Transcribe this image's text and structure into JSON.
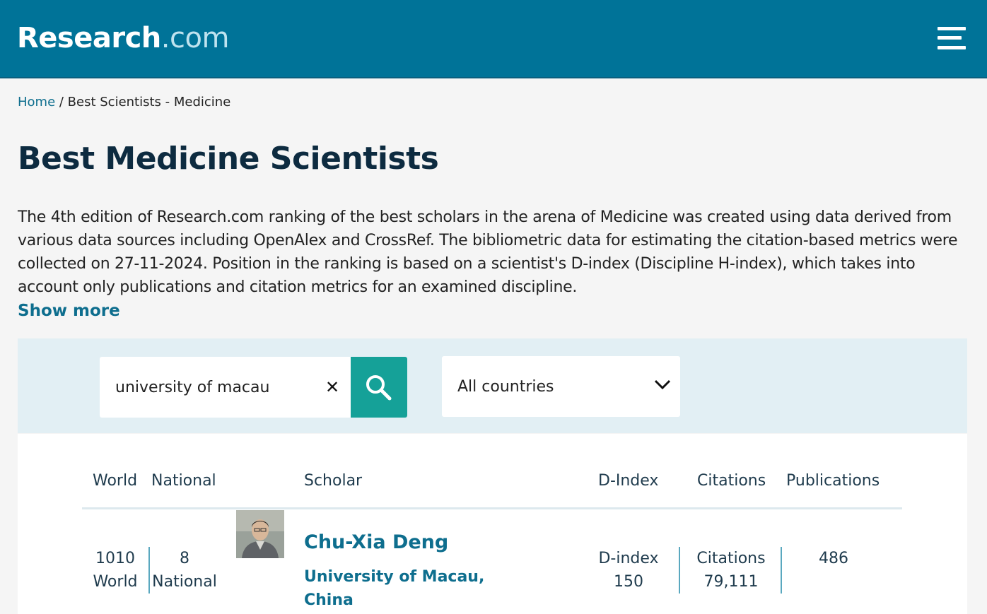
{
  "header": {
    "logo_main": "Research",
    "logo_domain": ".com",
    "menu_icon": "hamburger-menu-icon"
  },
  "breadcrumb": {
    "home": "Home",
    "separator": " / ",
    "current": "Best Scientists - Medicine"
  },
  "page": {
    "title": "Best Medicine Scientists",
    "intro": "The 4th edition of Research.com ranking of the best scholars in the arena of Medicine was created using data derived from various data sources including OpenAlex and CrossRef. The bibliometric data for estimating the citation-based metrics were collected on 27-11-2024. Position in the ranking is based on a scientist's D-index (Discipline H-index), which takes into account only publications and citation metrics for an examined discipline.",
    "show_more": "Show more"
  },
  "filters": {
    "search_value": "university of macau",
    "clear_symbol": "✕",
    "search_icon": "magnifier-icon",
    "country_selected": "All countries",
    "country_icon": "chevron-down-icon"
  },
  "table": {
    "headers": {
      "world": "World",
      "national": "National",
      "scholar": "Scholar",
      "dindex": "D-Index",
      "citations": "Citations",
      "publications": "Publications"
    },
    "rows": [
      {
        "world_rank": "1010",
        "world_label": "World",
        "national_rank": "8",
        "national_label": "National",
        "name": "Chu-Xia Deng",
        "affiliation": "University of Macau, China",
        "dindex_label": "D-index",
        "dindex_value": "150",
        "citations_label": "Citations",
        "citations_value": "79,111",
        "publications": "486"
      }
    ]
  },
  "colors": {
    "brand": "#007398",
    "link": "#0e6e8e",
    "search_button": "#15a198",
    "filter_panel": "#e2eff4"
  }
}
